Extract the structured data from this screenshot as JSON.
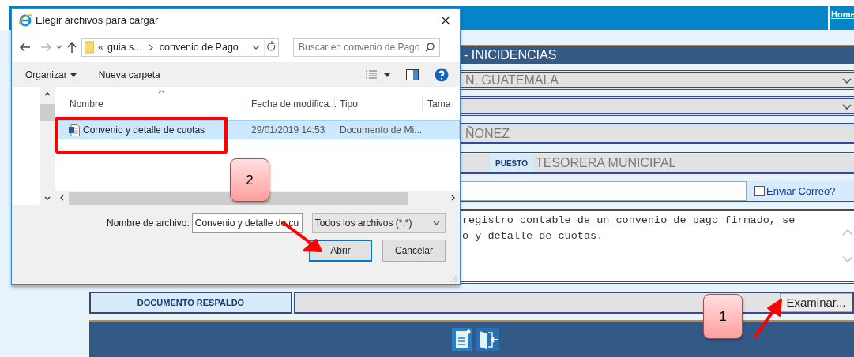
{
  "page": {
    "header_link": "Home",
    "section_title": "- INICIDENCIAS",
    "rows": [
      {
        "kind": "select",
        "value": "N, GUATEMALA"
      },
      {
        "kind": "select"
      },
      {
        "kind": "field",
        "value": "ÑONEZ"
      },
      {
        "kind": "labeled",
        "label": "PUESTO",
        "value": "TESORERA MUNICIPAL"
      },
      {
        "kind": "input_check",
        "check_label": "Enviar Correo?",
        "checked": false
      },
      {
        "kind": "textarea",
        "lines": [
          "registro contable de un convenio de pago firmado, se",
          "o y detalle de cuotas."
        ]
      },
      {
        "kind": "file",
        "label": "DOCUMENTO RESPALDO",
        "button": "Examinar..."
      }
    ]
  },
  "dialog": {
    "title": "Elegir archivos para cargar",
    "address": {
      "overflow": "«",
      "crumbs": [
        "guia s...",
        "convenio de Pago"
      ]
    },
    "search": {
      "placeholder": "Buscar en convenio de Pago"
    },
    "toolbar": {
      "organize": "Organizar",
      "new_folder": "Nueva carpeta"
    },
    "columns": [
      "Nombre",
      "Fecha de modifica...",
      "Tipo",
      "Tama"
    ],
    "files": [
      {
        "name": "Convenio y detalle de cuotas",
        "date": "29/01/2019 14:53",
        "type": "Documento de Mi...",
        "selected": true
      }
    ],
    "filename_label": "Nombre de archivo:",
    "filename": "Convenio y detalle de cu",
    "filetype": "Todos los archivos (*.*)",
    "buttons": [
      "Abrir",
      "Cancelar"
    ]
  },
  "annotations": [
    {
      "kind": "callout",
      "text": "2"
    },
    {
      "kind": "callout",
      "text": "1"
    }
  ]
}
